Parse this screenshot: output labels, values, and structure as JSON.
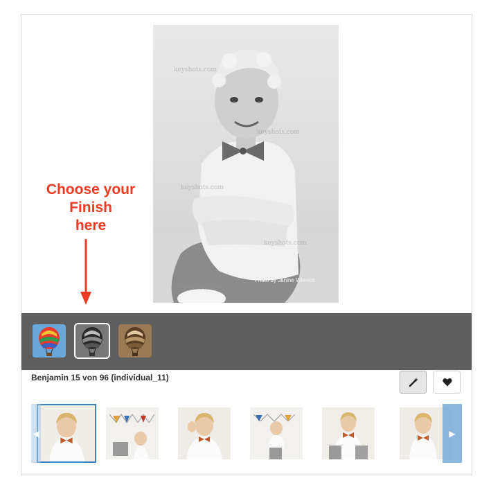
{
  "photo": {
    "alt": "Boy in white shirt with bow tie",
    "watermark": "keyshots.com",
    "credit": "Photo by Janine Wienick"
  },
  "annotation": {
    "lines": [
      "Choose your",
      "Finish",
      "here"
    ],
    "color": "#ef3b24"
  },
  "finishes": [
    {
      "name": "color",
      "icon": "hot-air-balloon-color-icon",
      "selected": false
    },
    {
      "name": "black-and-white",
      "icon": "hot-air-balloon-bw-icon",
      "selected": true
    },
    {
      "name": "sepia",
      "icon": "hot-air-balloon-sepia-icon",
      "selected": false
    }
  ],
  "caption": "Benjamin 15 von 96 (individual_11)",
  "actions": {
    "edit_icon": "magic-wand-icon",
    "favorite_icon": "heart-icon"
  },
  "thumbnails": [
    {
      "name": "thumb-1",
      "current": true
    },
    {
      "name": "thumb-2",
      "current": false
    },
    {
      "name": "thumb-3",
      "current": false
    },
    {
      "name": "thumb-4",
      "current": false
    },
    {
      "name": "thumb-5",
      "current": false
    },
    {
      "name": "thumb-6",
      "current": false
    }
  ],
  "nav": {
    "prev_icon": "chevron-left-icon",
    "next_icon": "chevron-right-icon"
  },
  "colors": {
    "accent": "#3b84c4",
    "finish_bar": "#5e5e5e"
  }
}
